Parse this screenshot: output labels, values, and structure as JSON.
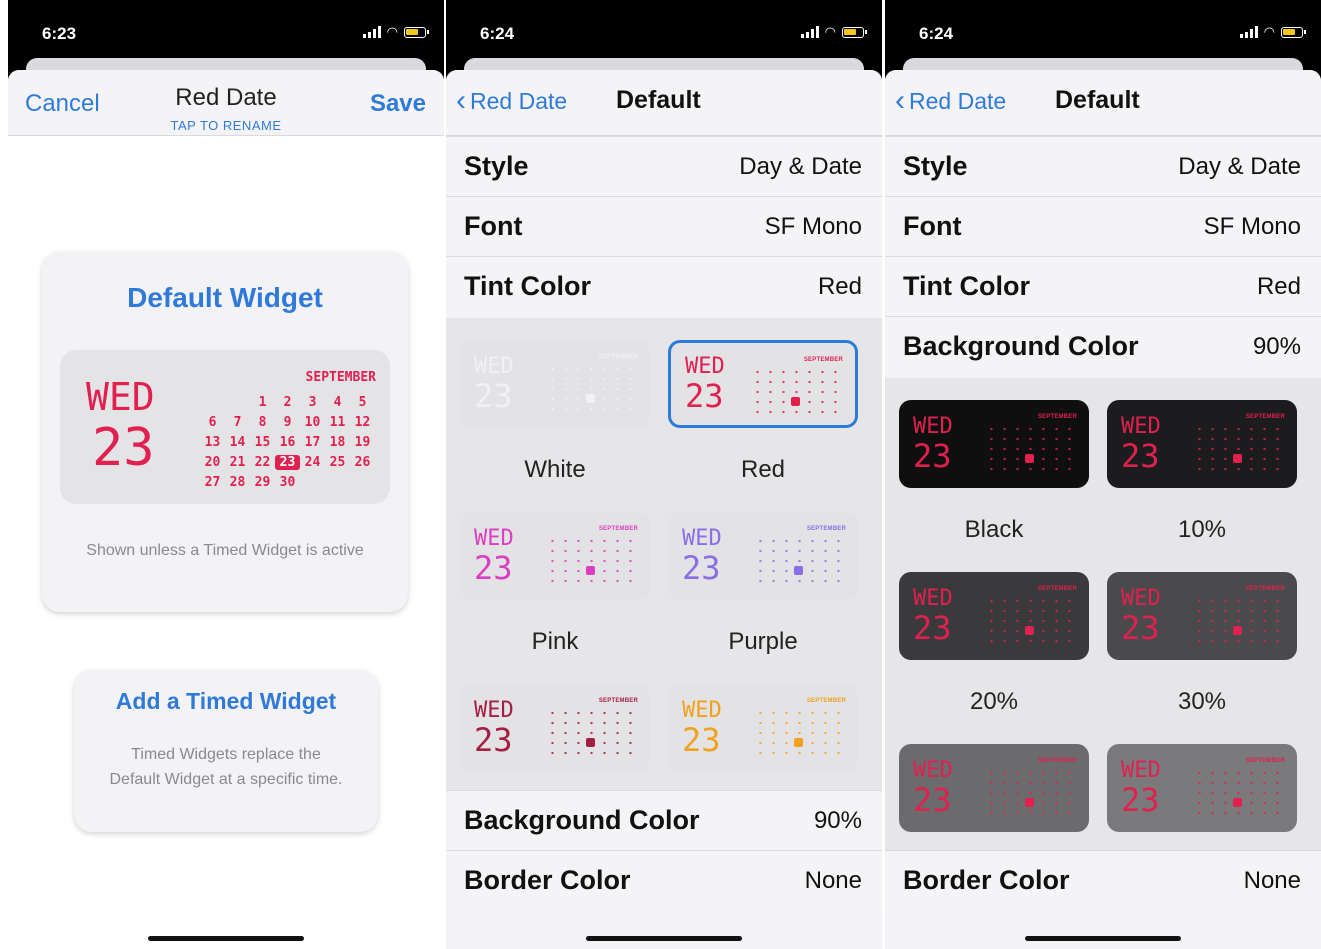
{
  "status": {
    "phone1_time": "6:23",
    "phone2_time": "6:24",
    "phone3_time": "6:24"
  },
  "screen1": {
    "cancel": "Cancel",
    "title": "Red Date",
    "subtitle": "TAP TO RENAME",
    "save": "Save",
    "default_card": {
      "title": "Default Widget",
      "weekday": "WED",
      "day": "23",
      "month": "SEPTEMBER",
      "weeks": [
        [
          "",
          "",
          "1",
          "2",
          "3",
          "4",
          "5"
        ],
        [
          "6",
          "7",
          "8",
          "9",
          "10",
          "11",
          "12"
        ],
        [
          "13",
          "14",
          "15",
          "16",
          "17",
          "18",
          "19"
        ],
        [
          "20",
          "21",
          "22",
          "23",
          "24",
          "25",
          "26"
        ],
        [
          "27",
          "28",
          "29",
          "30",
          "",
          "",
          ""
        ]
      ],
      "caption": "Shown unless a Timed Widget is active"
    },
    "timed_card": {
      "title": "Add a Timed Widget",
      "caption": "Timed Widgets replace the Default Widget at a specific time."
    }
  },
  "screen2": {
    "back": "Red Date",
    "title": "Default",
    "rows_top": [
      {
        "label": "Style",
        "value": "Day & Date"
      },
      {
        "label": "Font",
        "value": "SF Mono"
      },
      {
        "label": "Tint Color",
        "value": "Red"
      }
    ],
    "tint_options": [
      {
        "label": "White",
        "fg": "#f1f1f3",
        "bg": "#e3e3e6",
        "selected": false
      },
      {
        "label": "Red",
        "fg": "#e0204f",
        "bg": "#e3e3e6",
        "selected": true
      },
      {
        "label": "Pink",
        "fg": "#d93fbe",
        "bg": "#e3e3e6",
        "selected": false
      },
      {
        "label": "Purple",
        "fg": "#8a6ee6",
        "bg": "#e3e3e6",
        "selected": false
      },
      {
        "label": "",
        "fg": "#a51f45",
        "bg": "#e3e3e6",
        "selected": false
      },
      {
        "label": "",
        "fg": "#f0a21d",
        "bg": "#e3e3e6",
        "selected": false
      }
    ],
    "tile_text": {
      "weekday": "WED",
      "day": "23",
      "month": "SEPTEMBER"
    },
    "rows_bottom": [
      {
        "label": "Background Color",
        "value": "90%"
      },
      {
        "label": "Border Color",
        "value": "None"
      }
    ]
  },
  "screen3": {
    "back": "Red Date",
    "title": "Default",
    "rows_top": [
      {
        "label": "Style",
        "value": "Day & Date"
      },
      {
        "label": "Font",
        "value": "SF Mono"
      },
      {
        "label": "Tint Color",
        "value": "Red"
      },
      {
        "label": "Background Color",
        "value": "90%"
      }
    ],
    "bg_options": [
      {
        "label": "Black",
        "fg": "#e0204f",
        "bg": "#0f0f10"
      },
      {
        "label": "10%",
        "fg": "#e0204f",
        "bg": "#1c1c1e"
      },
      {
        "label": "20%",
        "fg": "#e0204f",
        "bg": "#3a3a3c"
      },
      {
        "label": "30%",
        "fg": "#e0204f",
        "bg": "#4a4a4c"
      },
      {
        "label": "",
        "fg": "#e0204f",
        "bg": "#6b6b6d"
      },
      {
        "label": "",
        "fg": "#e0204f",
        "bg": "#7a7a7c"
      }
    ],
    "tile_text": {
      "weekday": "WED",
      "day": "23",
      "month": "SEPTEMBER"
    },
    "rows_bottom": [
      {
        "label": "Border Color",
        "value": "None"
      }
    ]
  },
  "colors": {
    "accent_blue": "#2f7ad8",
    "tint_red": "#e0204f"
  }
}
